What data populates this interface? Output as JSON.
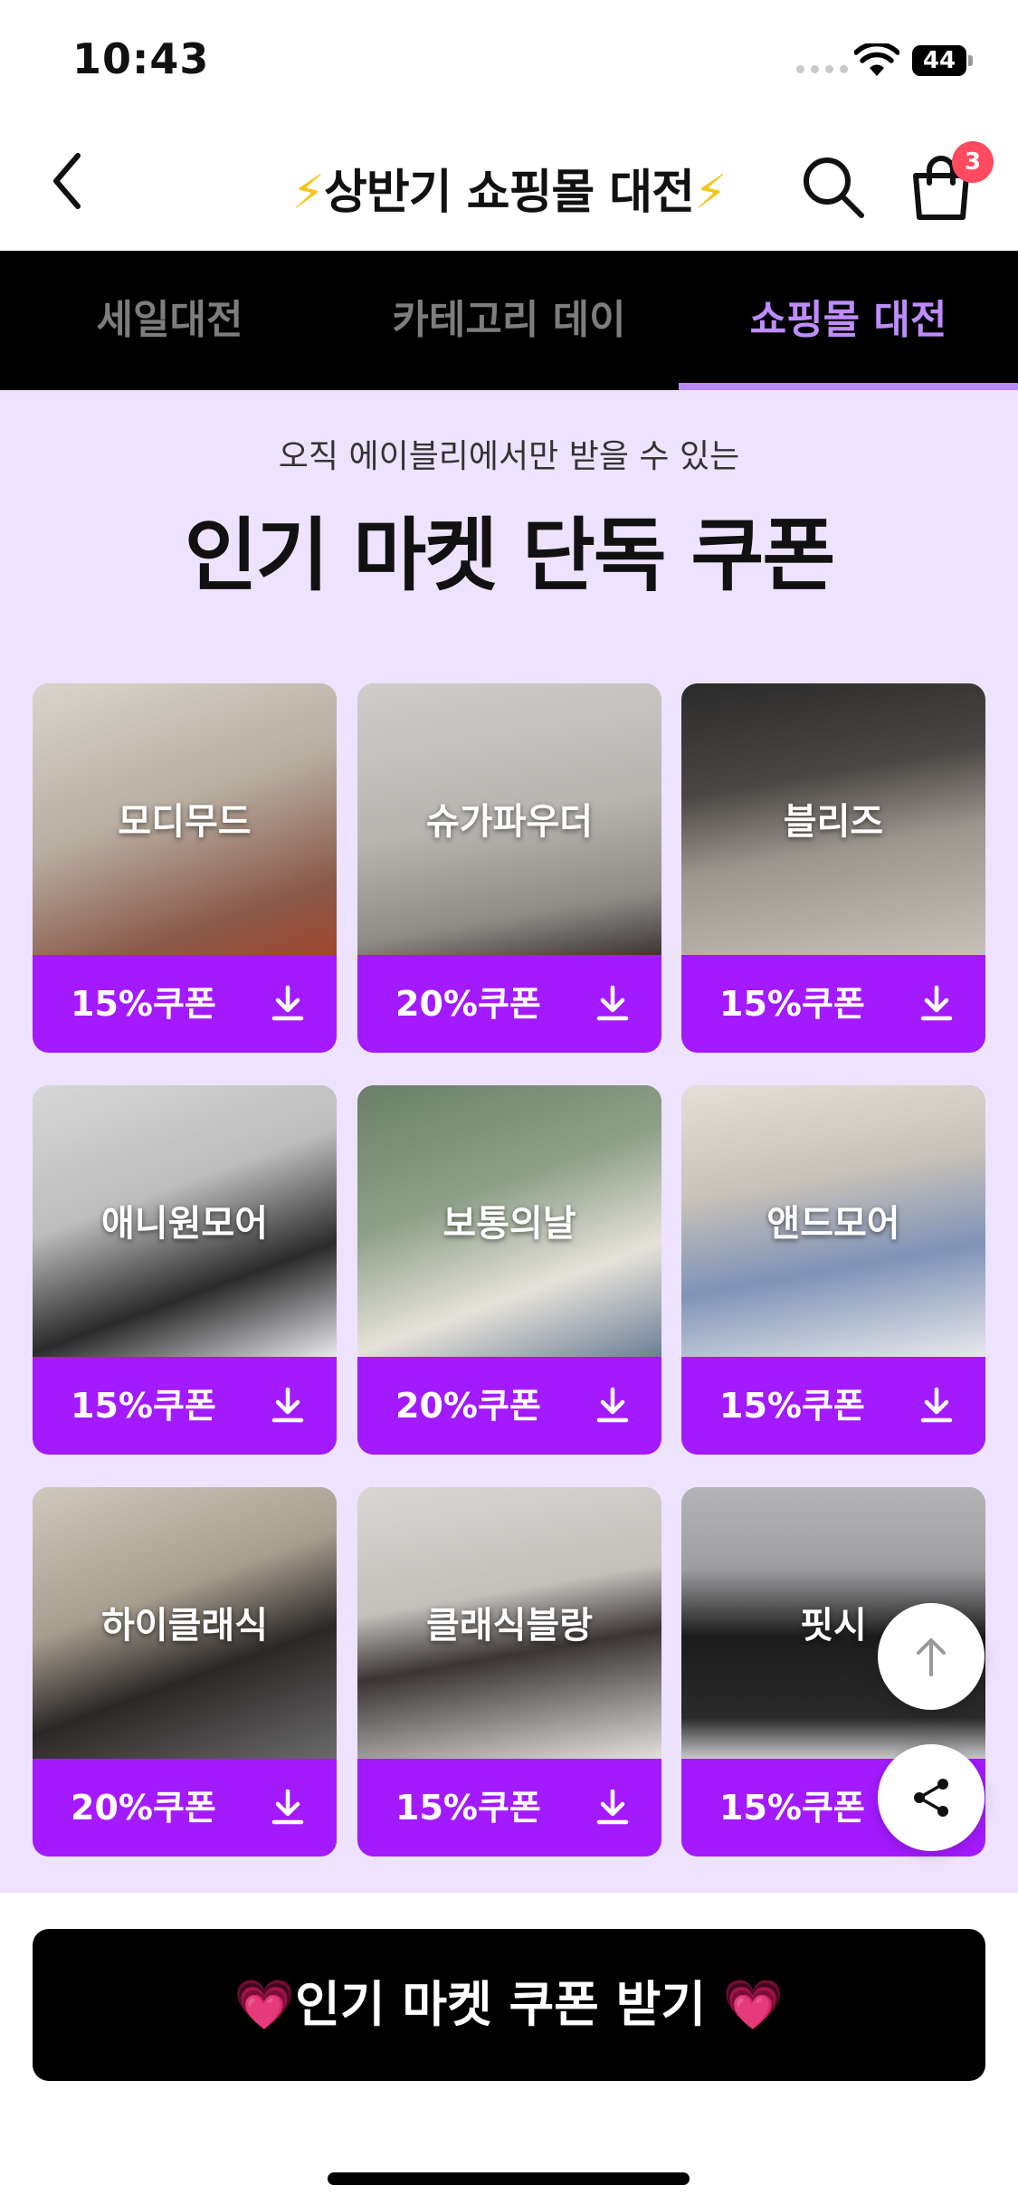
{
  "status_bar": {
    "time": "10:43",
    "battery": "44"
  },
  "header": {
    "title_text": "상반기 쇼핑몰 대전",
    "bolt": "⚡",
    "cart_count": "3"
  },
  "tabs": [
    {
      "label": "세일대전",
      "active": false
    },
    {
      "label": "카테고리 데이",
      "active": false
    },
    {
      "label": "쇼핑몰 대전",
      "active": true
    }
  ],
  "promo": {
    "subtitle": "오직 에이블리에서만 받을 수 있는",
    "title": "인기 마켓 단독 쿠폰"
  },
  "markets": [
    {
      "name": "모디무드",
      "coupon": "15%쿠폰"
    },
    {
      "name": "슈가파우더",
      "coupon": "20%쿠폰"
    },
    {
      "name": "블리즈",
      "coupon": "15%쿠폰"
    },
    {
      "name": "애니원모어",
      "coupon": "15%쿠폰"
    },
    {
      "name": "보통의날",
      "coupon": "20%쿠폰"
    },
    {
      "name": "앤드모어",
      "coupon": "15%쿠폰"
    },
    {
      "name": "하이클래식",
      "coupon": "20%쿠폰"
    },
    {
      "name": "클래식블랑",
      "coupon": "15%쿠폰"
    },
    {
      "name": "핏시",
      "coupon": "15%쿠폰"
    }
  ],
  "cta": {
    "label": "인기 마켓 쿠폰 받기",
    "heart": "💗"
  },
  "icons": {
    "back": "chevron-left-icon",
    "search": "search-icon",
    "cart": "shopping-bag-icon",
    "download": "download-icon",
    "scroll_top": "arrow-up-icon",
    "share": "share-icon"
  },
  "colors": {
    "accent_purple": "#a31aff",
    "tab_active": "#bf8cff",
    "content_bg": "#ede3ff",
    "badge": "#ff4a5f"
  }
}
